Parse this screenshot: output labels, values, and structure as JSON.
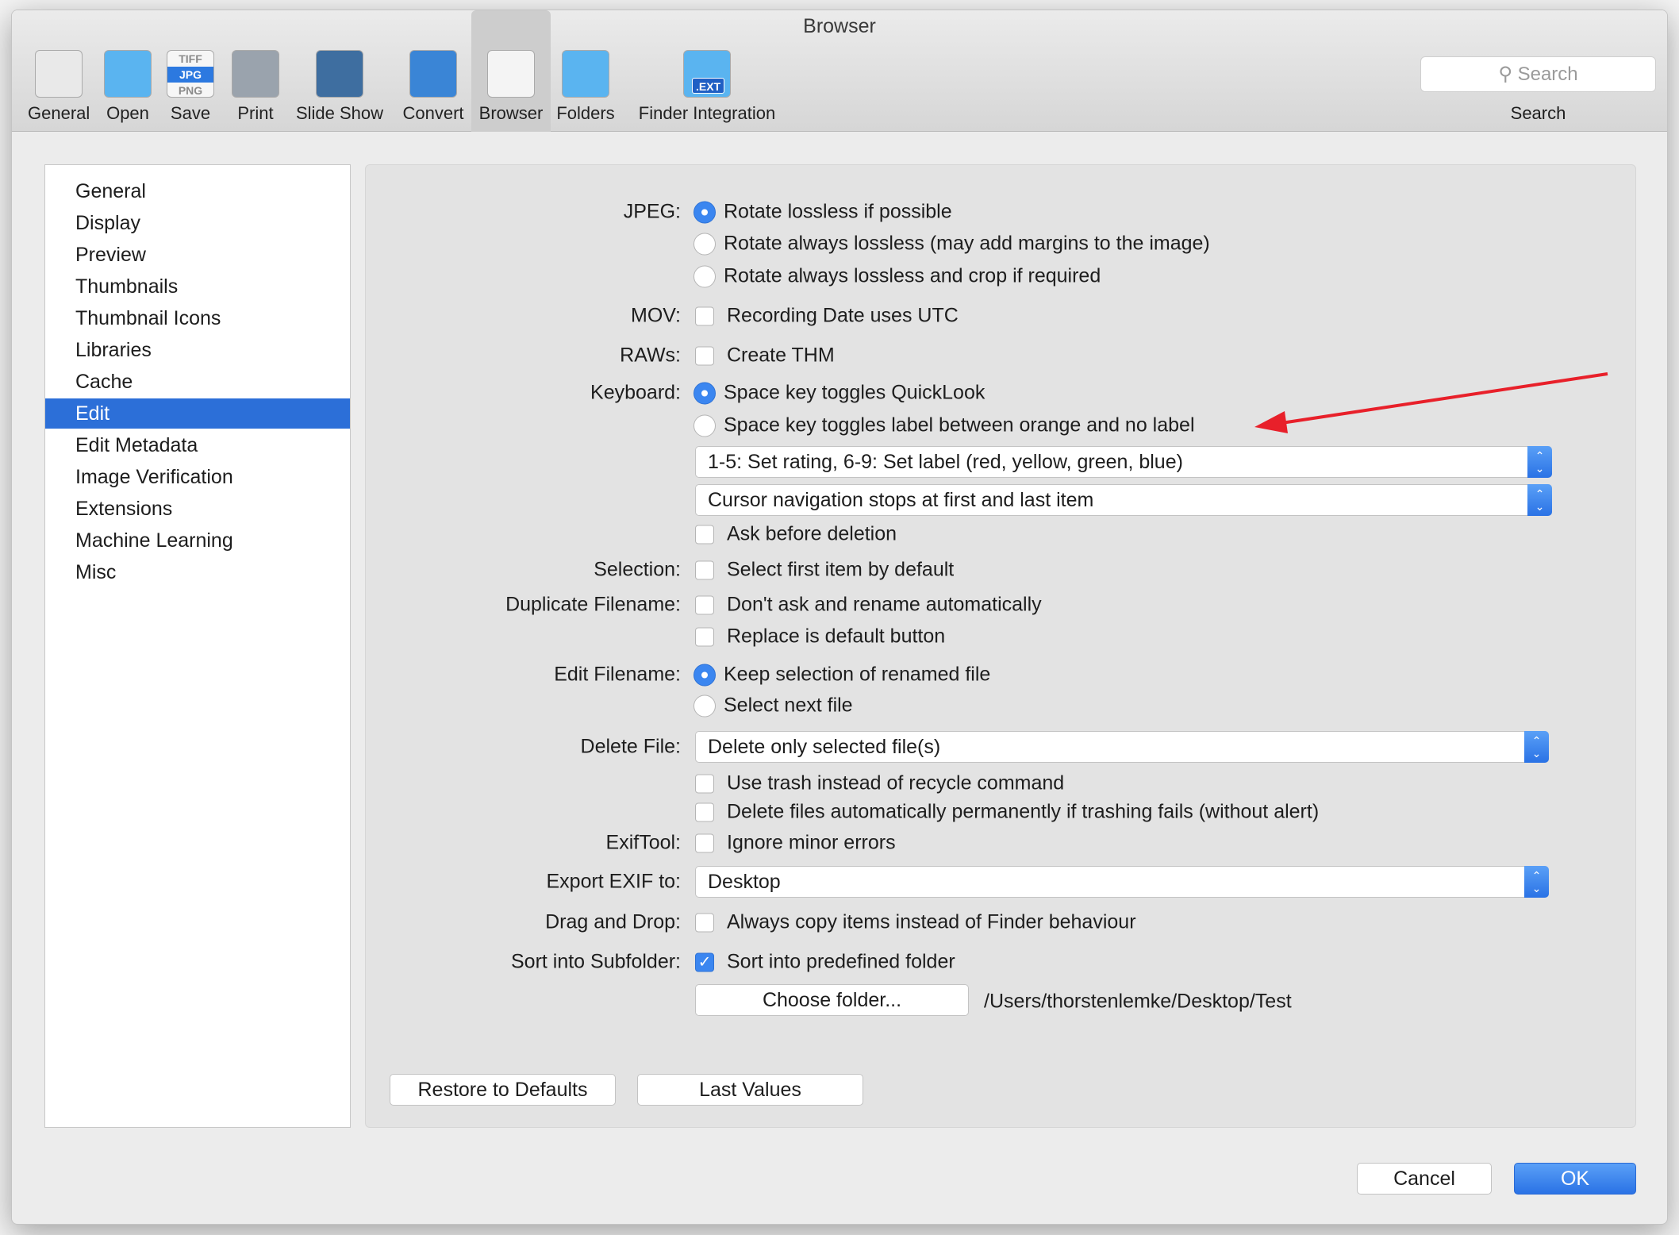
{
  "window": {
    "title": "Browser"
  },
  "toolbar": {
    "items": [
      {
        "label": "General",
        "icon": "switch-icon"
      },
      {
        "label": "Open",
        "icon": "folder-brush-icon"
      },
      {
        "label": "Save",
        "icon": "file-formats-icon",
        "formats": [
          "TIFF",
          "JPG",
          "PNG"
        ]
      },
      {
        "label": "Print",
        "icon": "printer-icon"
      },
      {
        "label": "Slide Show",
        "icon": "slideshow-icon"
      },
      {
        "label": "Convert",
        "icon": "convert-icon"
      },
      {
        "label": "Browser",
        "icon": "browser-icon",
        "selected": true
      },
      {
        "label": "Folders",
        "icon": "folder-photo-icon"
      },
      {
        "label": "Finder Integration",
        "icon": "folder-ext-icon",
        "badge": ".EXT"
      }
    ],
    "search": {
      "placeholder": "Search",
      "label": "Search"
    }
  },
  "sidebar": {
    "items": [
      "General",
      "Display",
      "Preview",
      "Thumbnails",
      "Thumbnail Icons",
      "Libraries",
      "Cache",
      "Edit",
      "Edit Metadata",
      "Image Verification",
      "Extensions",
      "Machine Learning",
      "Misc"
    ],
    "selected": "Edit"
  },
  "form": {
    "labels": {
      "jpeg": "JPEG:",
      "mov": "MOV:",
      "raws": "RAWs:",
      "keyboard": "Keyboard:",
      "selection": "Selection:",
      "duplicate": "Duplicate Filename:",
      "edit_filename": "Edit Filename:",
      "delete_file": "Delete File:",
      "exiftool": "ExifTool:",
      "export_exif": "Export EXIF to:",
      "drag_drop": "Drag  and Drop:",
      "sort": "Sort into Subfolder:"
    },
    "options": [
      {
        "type": "radio",
        "label": "Rotate lossless if possible",
        "checked": true
      },
      {
        "type": "radio",
        "label": "Rotate always lossless (may add margins to the image)",
        "checked": false
      },
      {
        "type": "radio",
        "label": "Rotate always lossless and crop if required",
        "checked": false
      },
      {
        "type": "checkbox",
        "label": "Recording Date uses UTC",
        "checked": false
      },
      {
        "type": "checkbox",
        "label": "Create THM",
        "checked": false
      },
      {
        "type": "radio",
        "label": "Space key toggles QuickLook",
        "checked": true
      },
      {
        "type": "radio",
        "label": "Space key toggles label between orange and no label",
        "checked": false
      },
      {
        "type": "popup",
        "label": "1-5: Set rating, 6-9: Set label (red, yellow, green, blue)"
      },
      {
        "type": "popup",
        "label": "Cursor navigation stops at first and last item"
      },
      {
        "type": "checkbox",
        "label": "Ask before deletion",
        "checked": false
      },
      {
        "type": "checkbox",
        "label": "Select first item by default",
        "checked": false
      },
      {
        "type": "checkbox",
        "label": "Don't ask and rename automatically",
        "checked": false
      },
      {
        "type": "checkbox",
        "label": "Replace is default button",
        "checked": false
      },
      {
        "type": "radio",
        "label": "Keep selection of renamed file",
        "checked": true
      },
      {
        "type": "radio",
        "label": "Select next file",
        "checked": false
      },
      {
        "type": "popup",
        "label": "Delete only selected file(s)"
      },
      {
        "type": "checkbox",
        "label": "Use trash instead of recycle command",
        "checked": false
      },
      {
        "type": "checkbox",
        "label": "Delete files automatically permanently if trashing fails (without alert)",
        "checked": false
      },
      {
        "type": "checkbox",
        "label": "Ignore minor errors",
        "checked": false
      },
      {
        "type": "popup",
        "label": "Desktop"
      },
      {
        "type": "checkbox",
        "label": "Always copy items instead of Finder behaviour",
        "checked": false
      },
      {
        "type": "checkbox",
        "label": "Sort into predefined folder",
        "checked": true
      }
    ],
    "choose_folder": "Choose folder...",
    "folder_path": "/Users/thorstenlemke/Desktop/Test"
  },
  "buttons": {
    "restore": "Restore to Defaults",
    "last_values": "Last Values",
    "cancel": "Cancel",
    "ok": "OK"
  },
  "annotation": {
    "color": "#e8202a",
    "icon": "red-arrow"
  },
  "colors": {
    "accent": "#2c6fd8"
  }
}
